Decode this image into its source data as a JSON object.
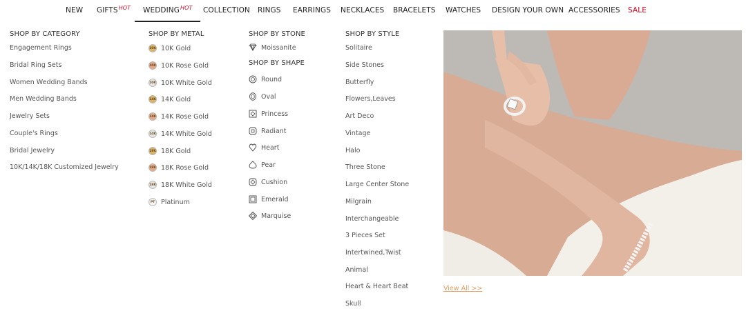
{
  "nav": {
    "items": [
      {
        "label": "NEW",
        "hot": ""
      },
      {
        "label": "GIFTS",
        "hot": "HOT"
      },
      {
        "label": "WEDDING",
        "hot": "HOT"
      },
      {
        "label": "COLLECTION",
        "hot": ""
      },
      {
        "label": "RINGS",
        "hot": ""
      },
      {
        "label": "EARRINGS",
        "hot": ""
      },
      {
        "label": "NECKLACES",
        "hot": ""
      },
      {
        "label": "BRACELETS",
        "hot": ""
      },
      {
        "label": "WATCHES",
        "hot": ""
      },
      {
        "label": "DESIGN YOUR OWN",
        "hot": ""
      },
      {
        "label": "ACCESSORIES",
        "hot": ""
      },
      {
        "label": "SALE",
        "hot": ""
      }
    ],
    "active_index": 2,
    "sale_color": "#d0021b"
  },
  "category": {
    "title": "SHOP BY CATEGORY",
    "items": [
      "Engagement Rings",
      "Bridal Ring Sets",
      "Women Wedding Bands",
      "Men Wedding Bands",
      "Jewelry Sets",
      "Couple's Rings",
      "Bridal Jewelry",
      "10K/14K/18K Customized Jewelry"
    ]
  },
  "metal": {
    "title": "SHOP BY METAL",
    "items": [
      {
        "label": "10K Gold",
        "badge": "10K",
        "color": "#d9b46a"
      },
      {
        "label": "10K Rose Gold",
        "badge": "10K",
        "color": "#e3a98c"
      },
      {
        "label": "10K White Gold",
        "badge": "10K",
        "color": "#e6e6e6"
      },
      {
        "label": "14K Gold",
        "badge": "14K",
        "color": "#d9b46a"
      },
      {
        "label": "14K Rose Gold",
        "badge": "14K",
        "color": "#e3a98c"
      },
      {
        "label": "14K White Gold",
        "badge": "14K",
        "color": "#e6e6e6"
      },
      {
        "label": "18K Gold",
        "badge": "18K",
        "color": "#d9b46a"
      },
      {
        "label": "18K Rose Gold",
        "badge": "18K",
        "color": "#e3a98c"
      },
      {
        "label": "18K White Gold",
        "badge": "18K",
        "color": "#e6e6e6"
      },
      {
        "label": "Platinum",
        "badge": "PT",
        "color": "#f4f4f4"
      }
    ]
  },
  "stone": {
    "title": "SHOP BY STONE",
    "items": [
      {
        "label": "Moissanite",
        "icon": "moissanite-icon"
      }
    ]
  },
  "shape": {
    "title": "SHOP BY SHAPE",
    "items": [
      {
        "label": "Round",
        "icon": "round-shape-icon"
      },
      {
        "label": "Oval",
        "icon": "oval-shape-icon"
      },
      {
        "label": "Princess",
        "icon": "princess-shape-icon"
      },
      {
        "label": "Radiant",
        "icon": "radiant-shape-icon"
      },
      {
        "label": "Heart",
        "icon": "heart-shape-icon"
      },
      {
        "label": "Pear",
        "icon": "pear-shape-icon"
      },
      {
        "label": "Cushion",
        "icon": "cushion-shape-icon"
      },
      {
        "label": "Emerald",
        "icon": "emerald-shape-icon"
      },
      {
        "label": "Marquise",
        "icon": "marquise-shape-icon"
      }
    ]
  },
  "style": {
    "title": "SHOP BY STYLE",
    "items": [
      "Solitaire",
      "Side Stones",
      "Butterfly",
      "Flowers,Leaves",
      "Art Deco",
      "Vintage",
      "Halo",
      "Three Stone",
      "Large Center Stone",
      "Milgrain",
      "Interchangeable",
      "3 Pieces Set",
      "Intertwined,Twist",
      "Animal",
      "Heart & Heart Beat",
      "Skull"
    ]
  },
  "promo": {
    "view_all": "View All >>",
    "link_color": "#e39a5b"
  }
}
